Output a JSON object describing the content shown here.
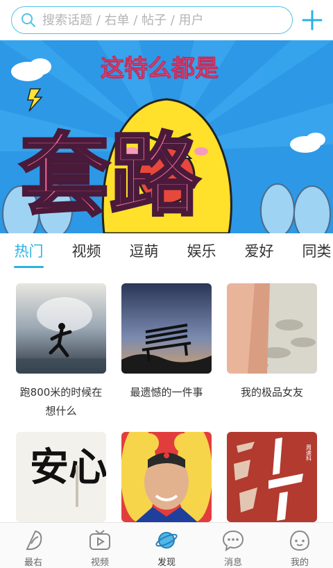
{
  "search": {
    "placeholder": "搜索话题 / 右单 / 帖子 / 用户"
  },
  "banner": {
    "headline": "这特么都是",
    "big_text": "套路"
  },
  "tabs": [
    {
      "label": "热门",
      "active": true
    },
    {
      "label": "视频"
    },
    {
      "label": "逗萌"
    },
    {
      "label": "娱乐"
    },
    {
      "label": "爱好"
    },
    {
      "label": "同类"
    }
  ],
  "topics": [
    {
      "title": "跑800米的时候在想什么"
    },
    {
      "title": "最遗憾的一件事"
    },
    {
      "title": "我的极品女友"
    },
    {
      "title": ""
    },
    {
      "title": ""
    },
    {
      "title": ""
    }
  ],
  "thumb_text": {
    "calligraphy": "安心",
    "book": "周速科"
  },
  "nav": [
    {
      "label": "最右",
      "icon": "zuiyou-icon"
    },
    {
      "label": "视频",
      "icon": "tv-icon"
    },
    {
      "label": "发现",
      "icon": "planet-icon",
      "active": true
    },
    {
      "label": "消息",
      "icon": "message-icon"
    },
    {
      "label": "我的",
      "icon": "profile-face-icon"
    }
  ],
  "colors": {
    "accent": "#2bb1e2",
    "banner_bg": "#2c98e6",
    "pink": "#f26a9a"
  }
}
